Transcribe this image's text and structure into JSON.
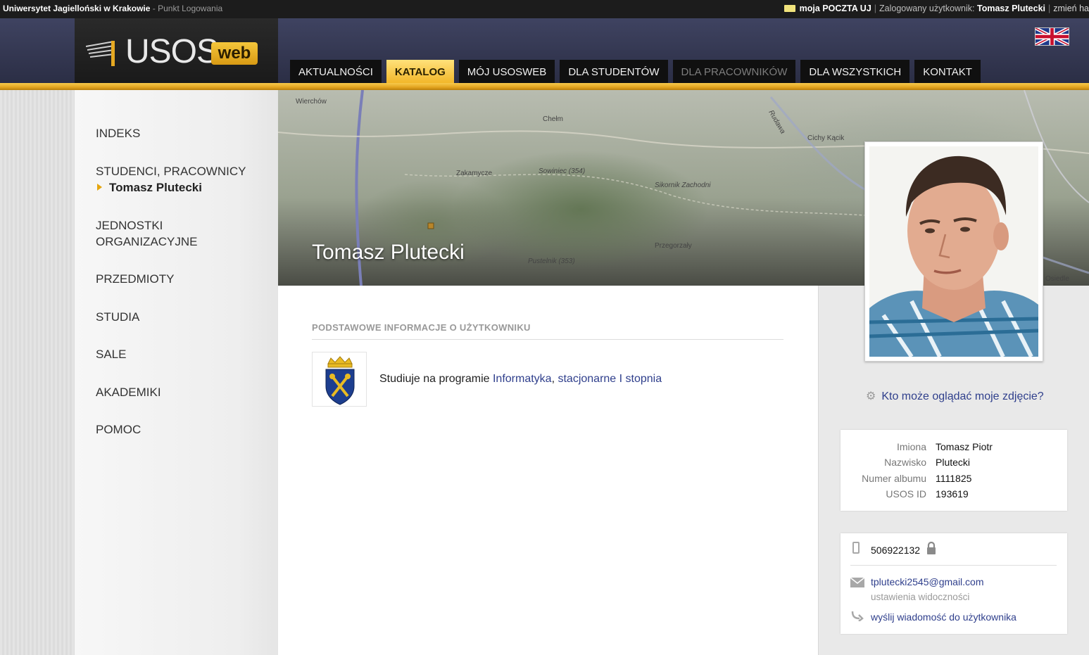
{
  "topbar": {
    "university": "Uniwersytet Jagielloński w Krakowie",
    "separator": " - ",
    "login_point": "Punkt Logowania",
    "mail_link": "moja POCZTA UJ",
    "logged_label": "Zalogowany użytkownik:",
    "user": "Tomasz Plutecki",
    "change": "zmień ha"
  },
  "logo": {
    "main": "USOS",
    "sub": "web"
  },
  "nav": [
    {
      "label": "AKTUALNOŚCI"
    },
    {
      "label": "KATALOG"
    },
    {
      "label": "MÓJ USOSWEB"
    },
    {
      "label": "DLA STUDENTÓW"
    },
    {
      "label": "DLA PRACOWNIKÓW"
    },
    {
      "label": "DLA WSZYSTKICH"
    },
    {
      "label": "KONTAKT"
    }
  ],
  "sidebar": {
    "items": [
      {
        "label": "INDEKS"
      },
      {
        "label": "STUDENCI, PRACOWNICY"
      },
      {
        "label": "JEDNOSTKI ORGANIZACYJNE"
      },
      {
        "label": "PRZEDMIOTY"
      },
      {
        "label": "STUDIA"
      },
      {
        "label": "SALE"
      },
      {
        "label": "AKADEMIKI"
      },
      {
        "label": "POMOC"
      }
    ],
    "current_person": "Tomasz Plutecki"
  },
  "map": {
    "labels": [
      "Wierchów",
      "Chełm",
      "Cichy Kącik",
      "Zakamycze",
      "Sowiniec (354)",
      "Sikornik Zachodni",
      "Przegorzały",
      "Pustelnik (353)",
      "Osiedle",
      "Rudawa"
    ],
    "title": "Tomasz Plutecki"
  },
  "main": {
    "section_title": "PODSTAWOWE INFORMACJE O UŻYTKOWNIKU",
    "program_prefix": "Studiuje na programie ",
    "program_link1": "Informatyka",
    "program_sep": ", ",
    "program_link2": "stacjonarne I stopnia"
  },
  "photo_link": "Kto może oglądać moje zdjęcie?",
  "info": {
    "rows": [
      {
        "key": "Imiona",
        "value": "Tomasz Piotr"
      },
      {
        "key": "Nazwisko",
        "value": "Plutecki"
      },
      {
        "key": "Numer albumu",
        "value": "1111825"
      },
      {
        "key": "USOS ID",
        "value": "193619"
      }
    ]
  },
  "contact": {
    "phone": "506922132",
    "email": "tplutecki2545@gmail.com",
    "visibility": "ustawienia widoczności",
    "send_message": "wyślij wiadomość do użytkownika"
  },
  "colors": {
    "accent_gold": "#f2b72a",
    "link_blue": "#2f3f8c",
    "header_navy": "#3f4361"
  }
}
